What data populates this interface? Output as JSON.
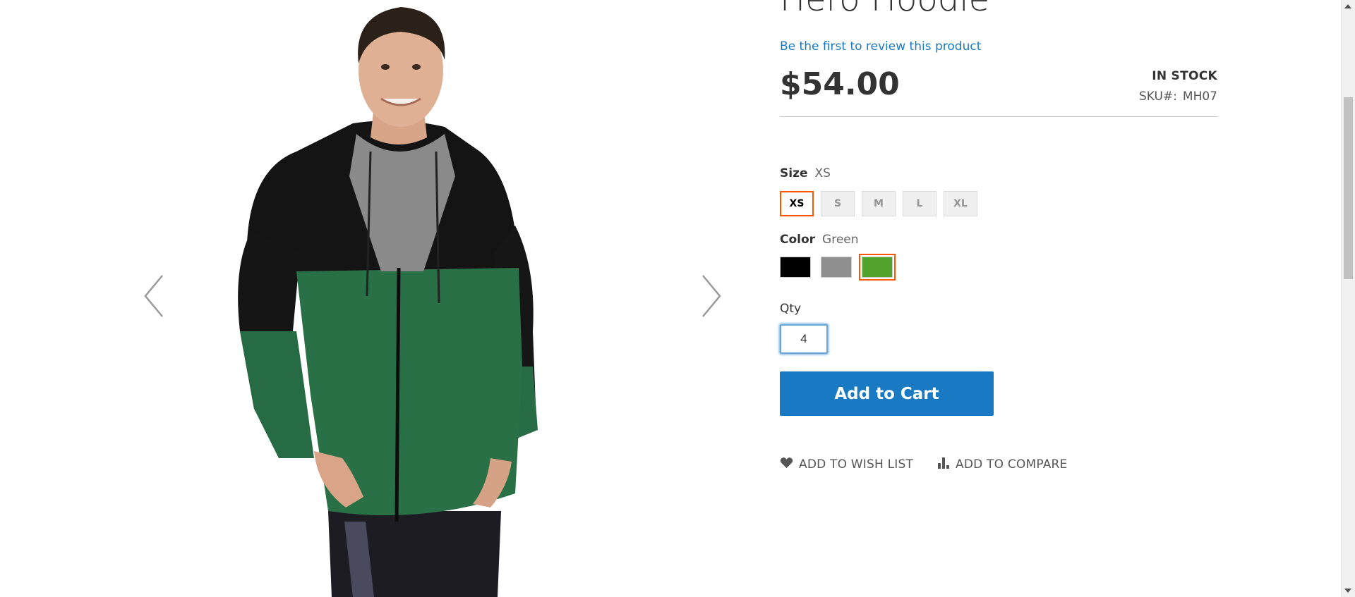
{
  "product": {
    "title": "Hero Hoodie",
    "review_link": "Be the first to review this product",
    "price": "$54.00",
    "stock": "IN STOCK",
    "sku_label": "SKU#:",
    "sku_value": "MH07"
  },
  "options": {
    "size": {
      "label": "Size",
      "selected": "XS",
      "values": [
        "XS",
        "S",
        "M",
        "L",
        "XL"
      ]
    },
    "color": {
      "label": "Color",
      "selected": "Green",
      "swatches": [
        {
          "name": "Black",
          "hex": "#000000"
        },
        {
          "name": "Gray",
          "hex": "#8f8f8f"
        },
        {
          "name": "Green",
          "hex": "#53a22b"
        }
      ]
    }
  },
  "qty": {
    "label": "Qty",
    "value": "4"
  },
  "cart_button": "Add to Cart",
  "actions": {
    "wishlist": "ADD TO WISH LIST",
    "compare": "ADD TO COMPARE"
  },
  "colors": {
    "accent_blue": "#1979c3",
    "selected_border": "#ff5501"
  }
}
